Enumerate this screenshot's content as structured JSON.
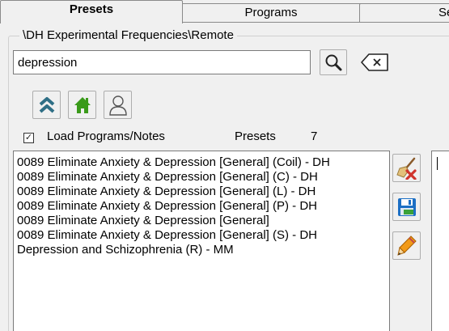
{
  "tabs": [
    {
      "label": "Presets",
      "active": true
    },
    {
      "label": "Programs",
      "active": false
    },
    {
      "label": "Set",
      "active": false
    }
  ],
  "group": {
    "title": "\\DH Experimental Frequencies\\Remote"
  },
  "search": {
    "value": "depression"
  },
  "load_programs": {
    "checked": true,
    "label": "Load Programs/Notes"
  },
  "presets": {
    "label": "Presets",
    "count": "7"
  },
  "list": {
    "items": [
      "0089 Eliminate Anxiety & Depression [General] (Coil) - DH",
      "0089 Eliminate Anxiety & Depression [General] (C) - DH",
      "0089 Eliminate Anxiety & Depression [General] (L) - DH",
      "0089 Eliminate Anxiety & Depression [General] (P) - DH",
      "0089 Eliminate Anxiety & Depression [General]",
      "0089 Eliminate Anxiety & Depression [General] (S) - DH",
      "Depression and Schizophrenia (R) - MM"
    ]
  },
  "icons": {
    "search": "magnifier-icon",
    "clear": "backspace-clear-icon",
    "up": "double-chevron-up-icon",
    "home": "home-icon",
    "user": "user-icon",
    "delete": "broom-delete-icon",
    "save": "floppy-save-icon",
    "edit": "pencil-edit-icon"
  },
  "colors": {
    "home_green": "#3a9a1a",
    "chevron_teal": "#2f6f86",
    "delete_red": "#d0342c",
    "save_blue": "#1c6fc4",
    "pencil_orange": "#f29a18"
  }
}
